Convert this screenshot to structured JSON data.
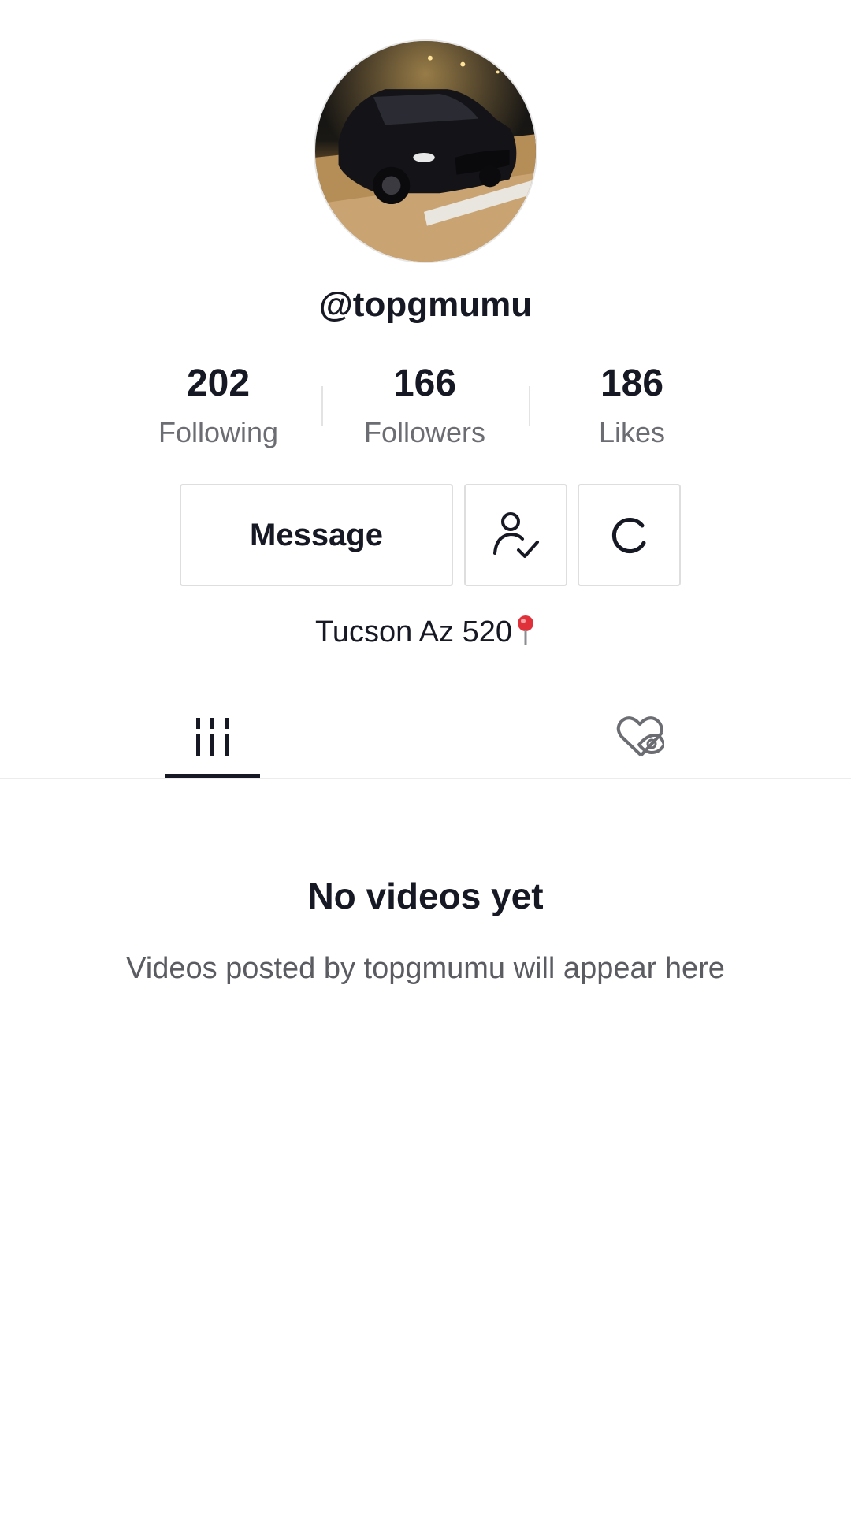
{
  "profile": {
    "username": "@topgmumu",
    "avatar_description": "avatar",
    "bio": "Tucson Az 520"
  },
  "stats": [
    {
      "value": "202",
      "label": "Following"
    },
    {
      "value": "166",
      "label": "Followers"
    },
    {
      "value": "186",
      "label": "Likes"
    }
  ],
  "actions": {
    "message_label": "Message",
    "follow_status_icon": "user-check-icon",
    "more_icon": "refresh-icon"
  },
  "tabs": [
    {
      "icon": "videos-grid-icon",
      "selected": true
    },
    {
      "icon": "liked-hidden-icon",
      "selected": false
    }
  ],
  "empty_state": {
    "title": "No videos yet",
    "subtitle": "Videos posted by topgmumu will appear here"
  },
  "colors": {
    "text_primary": "#161823",
    "text_secondary": "#6c6d72",
    "border": "#dedede",
    "pin_red": "#e0313a"
  }
}
